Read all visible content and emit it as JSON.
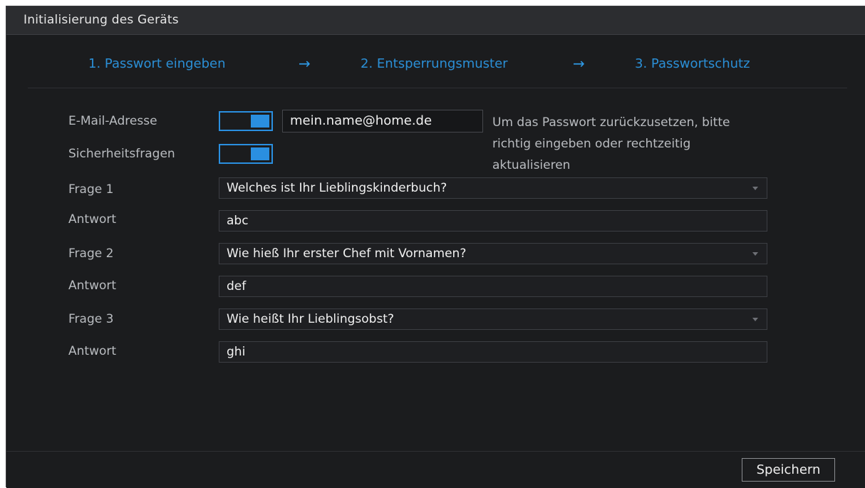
{
  "window": {
    "title": "Initialisierung des Geräts"
  },
  "steps": [
    {
      "label": "1.  Passwort eingeben"
    },
    {
      "label": "2.  Entsperrungsmuster"
    },
    {
      "label": "3.  Passwortschutz"
    }
  ],
  "arrow_glyph": "→",
  "form": {
    "email": {
      "label": "E-Mail-Adresse",
      "toggle_on": true,
      "value": "mein.name@home.de"
    },
    "security": {
      "label": "Sicherheitsfragen",
      "toggle_on": true
    },
    "hint": {
      "line1": "Um das Passwort zurückzusetzen, bitte",
      "line2": "richtig eingeben oder rechtzeitig",
      "line3": "aktualisieren"
    },
    "questions": [
      {
        "label": "Frage 1",
        "value": "Welches ist Ihr Lieblingskinderbuch?",
        "answer_label": "Antwort",
        "answer": "abc"
      },
      {
        "label": "Frage 2",
        "value": "Wie hieß Ihr erster Chef mit Vornamen?",
        "answer_label": "Antwort",
        "answer": "def"
      },
      {
        "label": "Frage 3",
        "value": "Wie heißt Ihr Lieblingsobst?",
        "answer_label": "Antwort",
        "answer": "ghi"
      }
    ]
  },
  "footer": {
    "save_label": "Speichern"
  },
  "colors": {
    "accent": "#2a8fe0",
    "step_text": "#2b8fd6",
    "background": "#1b1c1e",
    "titlebar": "#2c2d30"
  }
}
